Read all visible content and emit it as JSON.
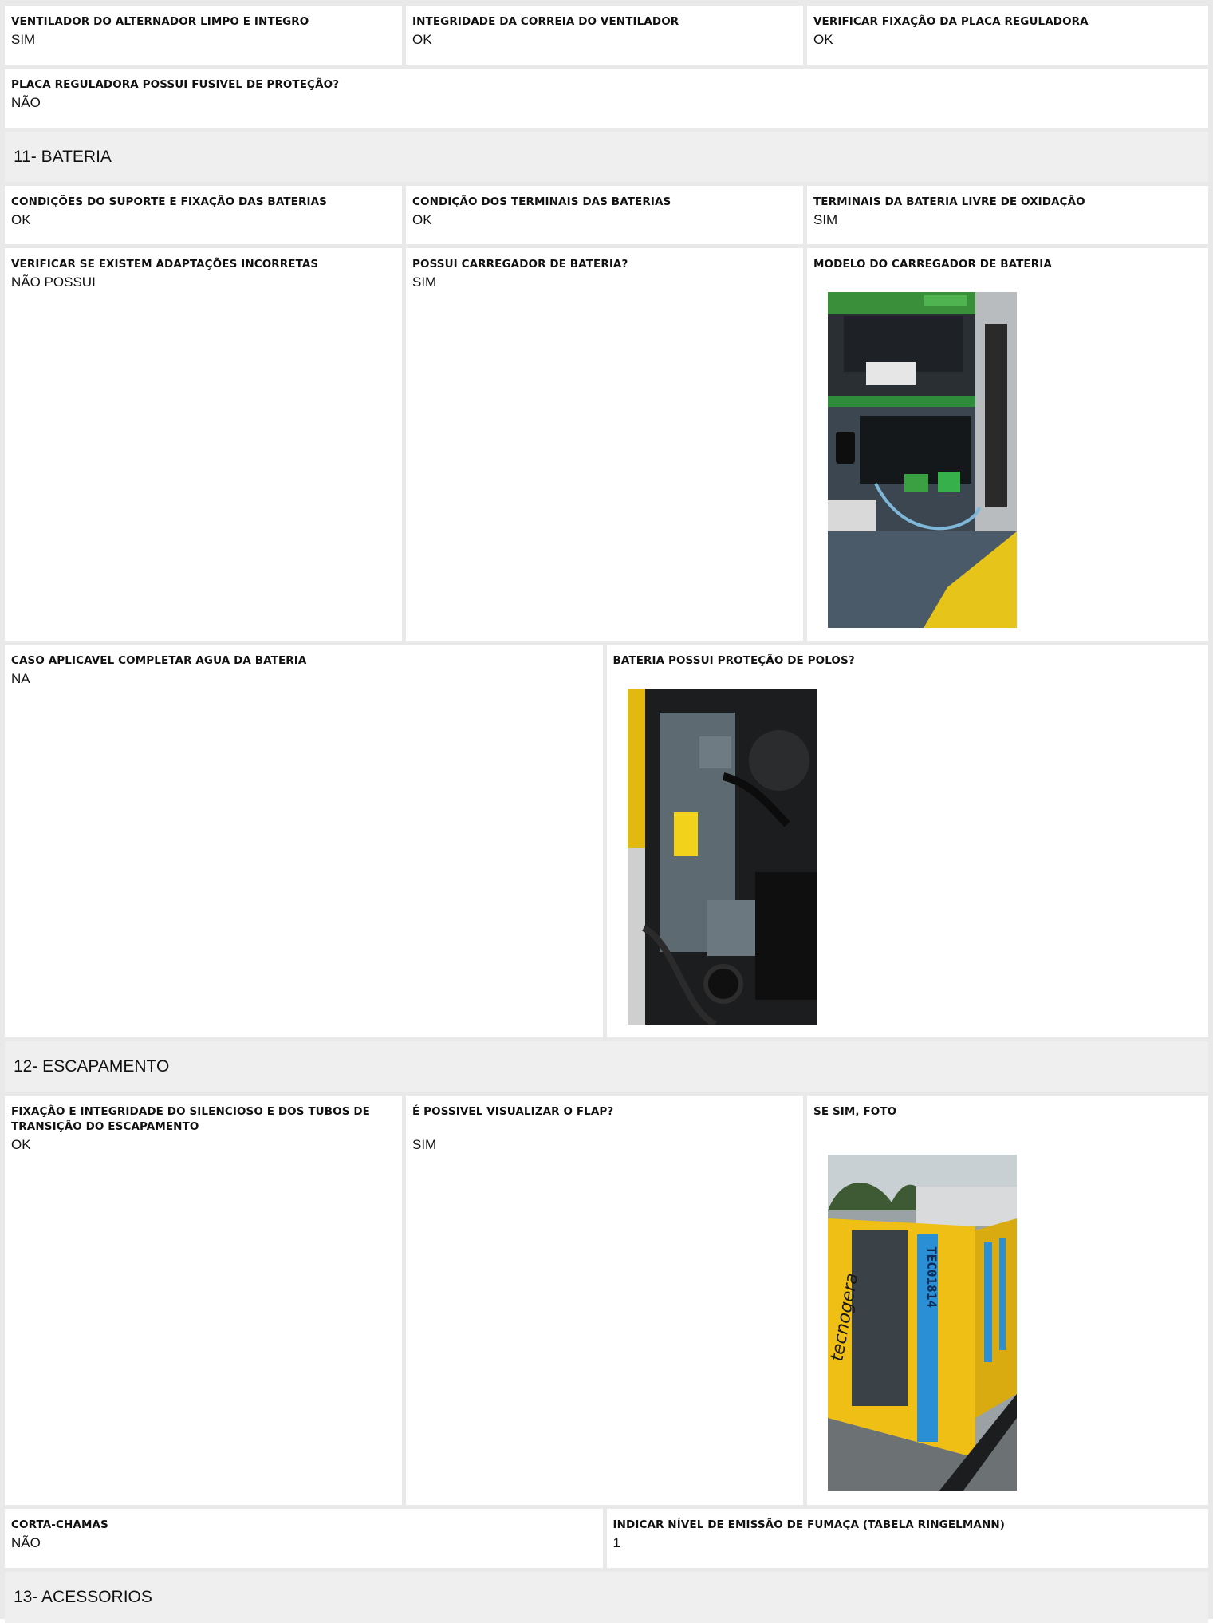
{
  "rows1": {
    "a": {
      "label": "VENTILADOR DO ALTERNADOR LIMPO E INTEGRO",
      "value": "SIM"
    },
    "b": {
      "label": "INTEGRIDADE DA CORREIA DO VENTILADOR",
      "value": "OK"
    },
    "c": {
      "label": "VERIFICAR FIXAÇÃO DA PLACA REGULADORA",
      "value": "OK"
    },
    "d": {
      "label": "PLACA REGULADORA POSSUI FUSIVEL DE PROTEÇÃO?",
      "value": "NÃO"
    }
  },
  "section11": {
    "title": "11- BATERIA"
  },
  "bateria": {
    "suporte": {
      "label": "CONDIÇÕES DO SUPORTE E FIXAÇÃO DAS BATERIAS",
      "value": "OK"
    },
    "terminais": {
      "label": "CONDIÇÃO DOS TERMINAIS DAS BATERIAS",
      "value": "OK"
    },
    "oxidacao": {
      "label": "TERMINAIS DA BATERIA LIVRE DE OXIDAÇÃO",
      "value": "SIM"
    },
    "adaptacoes": {
      "label": "VERIFICAR SE EXISTEM ADAPTAÇÕES INCORRETAS",
      "value": "NÃO POSSUI"
    },
    "carregador": {
      "label": "POSSUI CARREGADOR DE BATERIA?",
      "value": "SIM"
    },
    "modelo": {
      "label": "MODELO DO CARREGADOR DE BATERIA"
    },
    "agua": {
      "label": "CASO APLICAVEL COMPLETAR AGUA DA BATERIA",
      "value": "NA"
    },
    "polos": {
      "label": "BATERIA POSSUI PROTEÇÃO DE POLOS?"
    }
  },
  "section12": {
    "title": "12- ESCAPAMENTO"
  },
  "escapamento": {
    "fixacao": {
      "label": "FIXAÇÃO E INTEGRIDADE DO SILENCIOSO E DOS TUBOS DE TRANSIÇÃO DO ESCAPAMENTO",
      "value": "OK"
    },
    "flap": {
      "label": "É POSSIVEL VISUALIZAR O FLAP?",
      "value": "SIM"
    },
    "foto": {
      "label": "SE SIM, FOTO"
    },
    "corta": {
      "label": "CORTA-CHAMAS",
      "value": "NÃO"
    },
    "fumaca": {
      "label": "INDICAR NÍVEL DE EMISSÃO DE FUMAÇA (TABELA RINGELMANN)",
      "value": "1"
    }
  },
  "section13": {
    "title": "13- ACESSORIOS"
  },
  "photo_text": {
    "brand_vertical": "tecnogera",
    "unit_code": "TEC01814"
  },
  "colors": {
    "border": "#e9e9e9",
    "section_bg": "#efefef",
    "yellow": "#f2c300",
    "blue": "#2b8fd6"
  }
}
